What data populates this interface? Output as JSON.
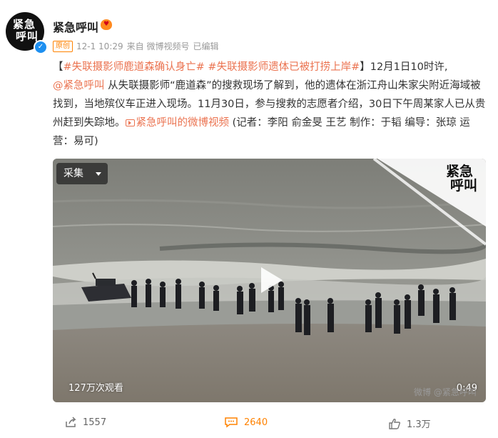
{
  "user": {
    "avatar_text_line1": "紧急",
    "avatar_text_line2": "呼叫",
    "name": "紧急呼叫",
    "verified_icon": "check-icon"
  },
  "meta": {
    "original_tag": "原创",
    "time": "12-1 10:29",
    "source": "来自 微博视频号",
    "edited": "已编辑"
  },
  "post": {
    "bracket_open": "【",
    "topic1": "#失联摄影师鹿道森确认身亡#",
    "topic2": "#失联摄影师遗体已被打捞上岸#",
    "bracket_close_text": "】12月1日10时许,",
    "mention": "@紧急呼叫",
    "body": " 从失联摄影师“鹿道森”的搜救现场了解到，他的遗体在浙江舟山朱家尖附近海域被找到，当地殡仪车正进入现场。11月30日，参与搜救的志愿者介绍，30日下午周某家人已从贵州赶到失踪地。",
    "video_link": "紧急呼叫的微博视频",
    "credits": " (记者：李阳 俞金旻 王艺 制作：于韬 编导：张琼 运营：易可)"
  },
  "video": {
    "collect_label": "采集",
    "views": "127万次观看",
    "duration": "0:49",
    "corner_logo_line1": "紧急",
    "corner_logo_line2": "呼叫",
    "watermark": "微博 @紧急呼叫"
  },
  "actions": {
    "share_count": "1557",
    "comment_count": "2640",
    "like_count": "1.3万"
  },
  "colors": {
    "accent": "#eb7350",
    "brand_orange": "#ff8200",
    "verified_blue": "#1d8ff0"
  }
}
